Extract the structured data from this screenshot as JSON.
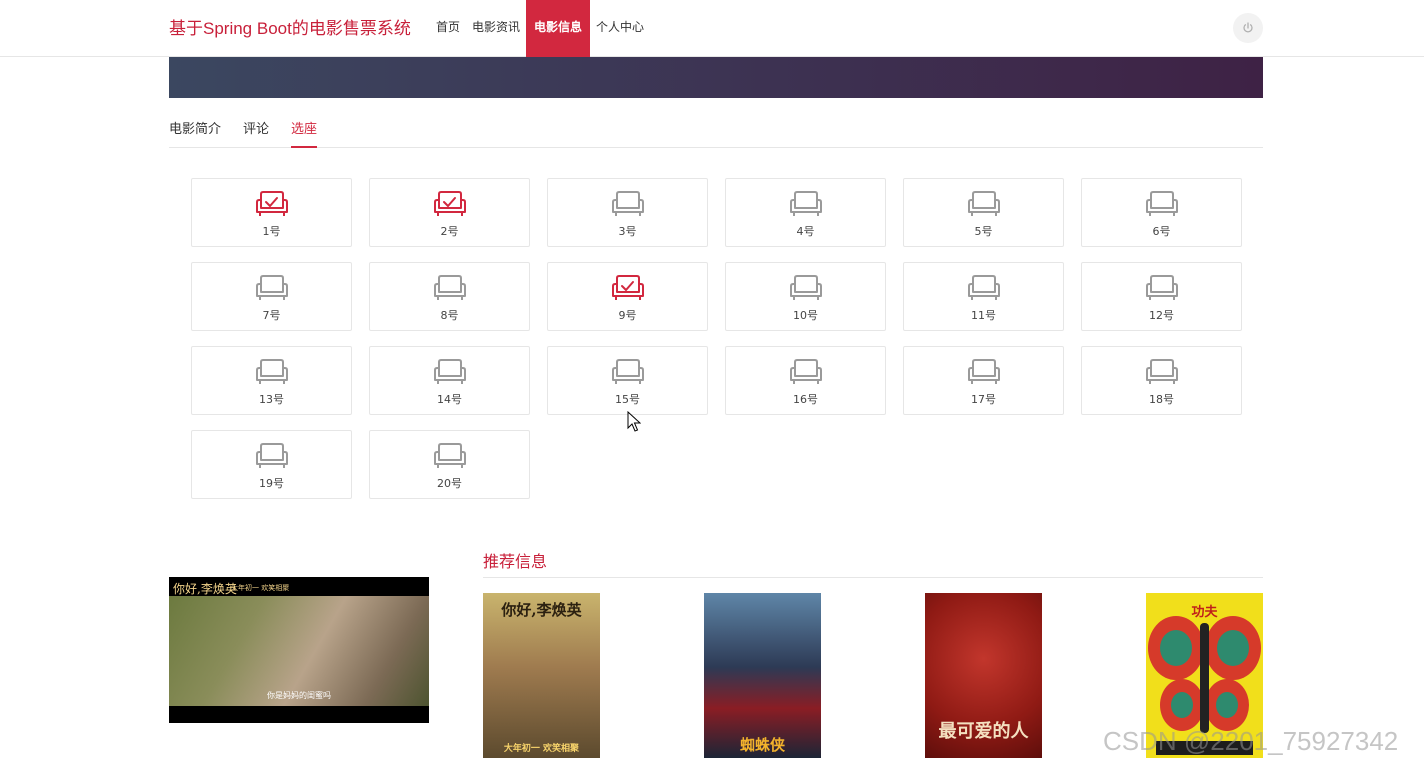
{
  "header": {
    "site_title": "基于Spring Boot的电影售票系统",
    "nav": [
      {
        "label": "首页",
        "active": false
      },
      {
        "label": "电影资讯",
        "active": false
      },
      {
        "label": "电影信息",
        "active": true
      },
      {
        "label": "个人中心",
        "active": false
      }
    ],
    "power_icon": "power-icon"
  },
  "tabs": [
    {
      "label": "电影简介",
      "active": false
    },
    {
      "label": "评论",
      "active": false
    },
    {
      "label": "选座",
      "active": true
    }
  ],
  "seats": [
    {
      "label": "1号",
      "selected": true
    },
    {
      "label": "2号",
      "selected": true
    },
    {
      "label": "3号",
      "selected": false
    },
    {
      "label": "4号",
      "selected": false
    },
    {
      "label": "5号",
      "selected": false
    },
    {
      "label": "6号",
      "selected": false
    },
    {
      "label": "7号",
      "selected": false
    },
    {
      "label": "8号",
      "selected": false
    },
    {
      "label": "9号",
      "selected": true
    },
    {
      "label": "10号",
      "selected": false
    },
    {
      "label": "11号",
      "selected": false
    },
    {
      "label": "12号",
      "selected": false
    },
    {
      "label": "13号",
      "selected": false
    },
    {
      "label": "14号",
      "selected": false
    },
    {
      "label": "15号",
      "selected": false
    },
    {
      "label": "16号",
      "selected": false
    },
    {
      "label": "17号",
      "selected": false
    },
    {
      "label": "18号",
      "selected": false
    },
    {
      "label": "19号",
      "selected": false
    },
    {
      "label": "20号",
      "selected": false
    }
  ],
  "recommend": {
    "title": "推荐信息",
    "video": {
      "title": "你好,李焕英",
      "subtitle": "大年初一 欢笑相聚",
      "caption": "你是妈妈的闺蜜吗"
    },
    "posters": [
      {
        "text": "你好,李焕英",
        "bottom_text": "大年初一 欢笑相聚"
      },
      {
        "text": "",
        "bottom_text": "蜘蛛侠"
      },
      {
        "text": "",
        "bottom_text": "最可爱的人"
      },
      {
        "text": "功夫",
        "bottom_text": ""
      }
    ]
  },
  "watermark": "CSDN @2201_75927342",
  "colors": {
    "accent": "#d2283f",
    "seat_selected": "#d2283f",
    "seat_free": "#9a9a9a"
  }
}
